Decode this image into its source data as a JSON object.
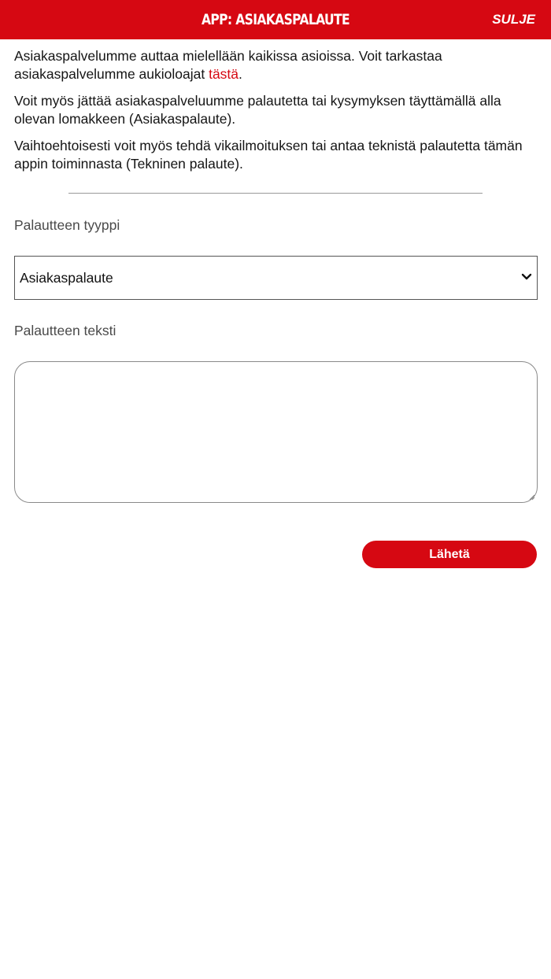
{
  "header": {
    "title": "APP: ASIAKASPALAUTE",
    "close_label": "SULJE",
    "bg_color": "#d60812"
  },
  "intro": {
    "p1_text": "Asiakaspalvelumme auttaa mielellään kaikissa asioissa. Voit tarkastaa asiakaspalvelumme aukioloajat ",
    "p1_link": "tästä",
    "p1_end": ".",
    "p2": "Voit myös jättää asiakaspalveluumme palautetta tai kysymyksen täyttämällä alla olevan lomakkeen (Asiakaspalaute).",
    "p3": "Vaihtoehtoisesti voit myös tehdä vikailmoituksen tai antaa teknistä palautetta tämän appin toiminnasta (Tekninen palaute)."
  },
  "form": {
    "type_label": "Palautteen tyyppi",
    "type_selected": "Asiakaspalaute",
    "text_label": "Palautteen teksti",
    "text_value": "",
    "submit_label": "Lähetä"
  },
  "icons": {
    "select_arrow": "chevron-down-icon",
    "resize": "resize-grip-icon"
  }
}
